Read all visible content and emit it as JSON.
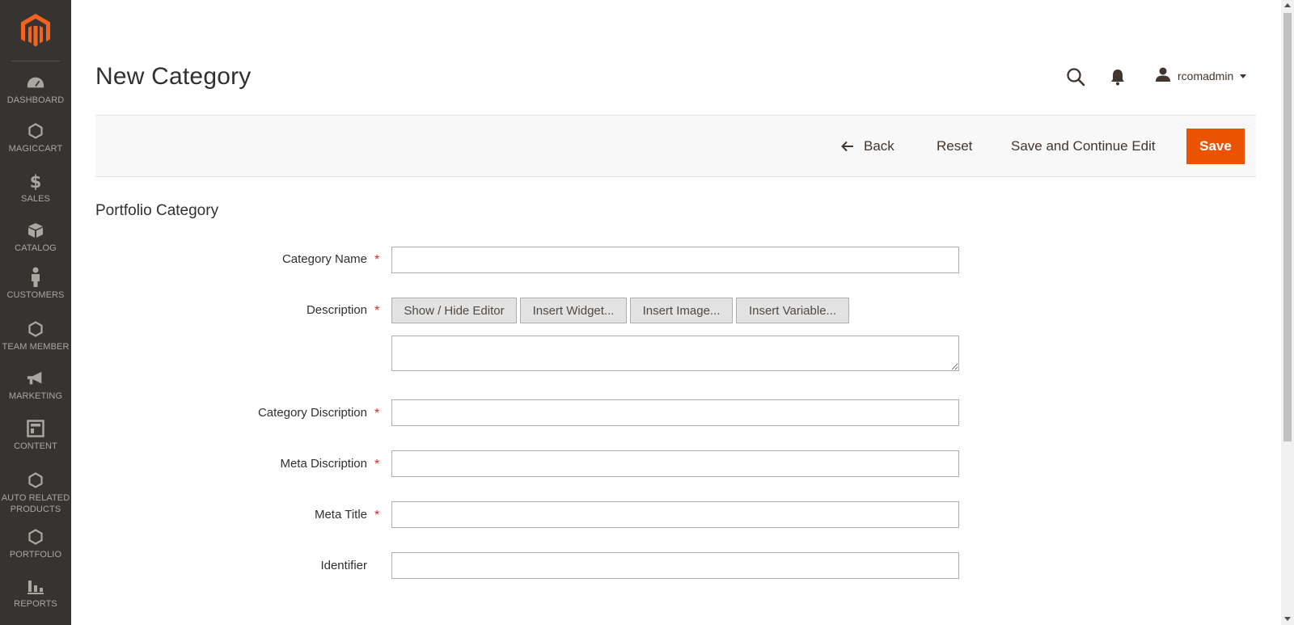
{
  "sidebar": {
    "logo_icon": "magento-logo-icon",
    "items": [
      {
        "label": "DASHBOARD",
        "icon": "dashboard-icon"
      },
      {
        "label": "MAGICCART",
        "icon": "hexagon-icon"
      },
      {
        "label": "SALES",
        "icon": "dollar-icon"
      },
      {
        "label": "CATALOG",
        "icon": "box-icon"
      },
      {
        "label": "CUSTOMERS",
        "icon": "person-icon"
      },
      {
        "label": "TEAM MEMBER",
        "icon": "hexagon-icon"
      },
      {
        "label": "MARKETING",
        "icon": "megaphone-icon"
      },
      {
        "label": "CONTENT",
        "icon": "layout-icon"
      },
      {
        "label": "AUTO RELATED PRODUCTS",
        "icon": "hexagon-icon"
      },
      {
        "label": "PORTFOLIO",
        "icon": "hexagon-icon"
      },
      {
        "label": "REPORTS",
        "icon": "bar-chart-icon"
      }
    ]
  },
  "header": {
    "title": "New Category",
    "username": "rcomadmin"
  },
  "actions": {
    "back": "Back",
    "reset": "Reset",
    "save_continue": "Save and Continue Edit",
    "save": "Save"
  },
  "form": {
    "section_title": "Portfolio Category",
    "required_mark": "*",
    "fields": {
      "category_name": {
        "label": "Category Name",
        "value": ""
      },
      "description": {
        "label": "Description",
        "value": ""
      },
      "category_description": {
        "label": "Category Discription",
        "value": ""
      },
      "meta_description": {
        "label": "Meta Discription",
        "value": ""
      },
      "meta_title": {
        "label": "Meta Title",
        "value": ""
      },
      "identifier": {
        "label": "Identifier",
        "value": ""
      }
    },
    "editor_buttons": {
      "show_hide": "Show / Hide Editor",
      "insert_widget": "Insert Widget...",
      "insert_image": "Insert Image...",
      "insert_variable": "Insert Variable..."
    }
  },
  "colors": {
    "sidebar_bg": "#373330",
    "accent": "#eb5202",
    "required": "#e22626"
  }
}
